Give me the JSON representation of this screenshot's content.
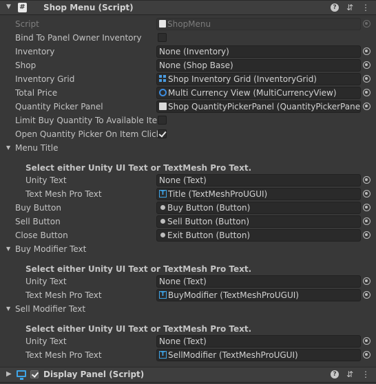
{
  "header": {
    "title": "Shop Menu (Script)",
    "icon": "hash-script-icon"
  },
  "footer": {
    "title": "Display Panel (Script)",
    "icon": "monitor-icon"
  },
  "fields": {
    "script": {
      "label": "Script",
      "value": "ShopMenu"
    },
    "bind": {
      "label": "Bind To Panel Owner Inventory",
      "checked": false
    },
    "inventory": {
      "label": "Inventory",
      "value": "None (Inventory)"
    },
    "shop": {
      "label": "Shop",
      "value": "None (Shop Base)"
    },
    "inventory_grid": {
      "label": "Inventory Grid",
      "value": "Shop Inventory Grid (InventoryGrid)"
    },
    "total_price": {
      "label": "Total Price",
      "value": "Multi Currency View (MultiCurrencyView)"
    },
    "qty_panel": {
      "label": "Quantity Picker Panel",
      "value": "Shop QuantityPickerPanel (QuantityPickerPanel)"
    },
    "limit_buy": {
      "label": "Limit Buy Quantity To Available Item",
      "checked": false
    },
    "open_qty": {
      "label": "Open Quantity Picker On Item Click",
      "checked": true
    },
    "menu_title": {
      "label": "Menu Title"
    },
    "menu_title_hint": "Select either Unity UI Text or TextMesh Pro Text.",
    "menu_title_unity": {
      "label": "Unity Text",
      "value": "None (Text)"
    },
    "menu_title_tmp": {
      "label": "Text Mesh Pro Text",
      "value": "Title (TextMeshProUGUI)"
    },
    "buy_button": {
      "label": "Buy Button",
      "value": "Buy Button (Button)"
    },
    "sell_button": {
      "label": "Sell Button",
      "value": "Sell Button (Button)"
    },
    "close_button": {
      "label": "Close Button",
      "value": "Exit Button (Button)"
    },
    "buy_mod": {
      "label": "Buy Modifier Text"
    },
    "buy_mod_hint": "Select either Unity UI Text or TextMesh Pro Text.",
    "buy_mod_unity": {
      "label": "Unity Text",
      "value": "None (Text)"
    },
    "buy_mod_tmp": {
      "label": "Text Mesh Pro Text",
      "value": "BuyModifier (TextMeshProUGUI)"
    },
    "sell_mod": {
      "label": "Sell Modifier Text"
    },
    "sell_mod_hint": "Select either Unity UI Text or TextMesh Pro Text.",
    "sell_mod_unity": {
      "label": "Unity Text",
      "value": "None (Text)"
    },
    "sell_mod_tmp": {
      "label": "Text Mesh Pro Text",
      "value": "SellModifier (TextMeshProUGUI)"
    }
  },
  "colors": {
    "panel": "#383838",
    "field": "#2a2a2a",
    "accent": "#3fa5e8"
  }
}
